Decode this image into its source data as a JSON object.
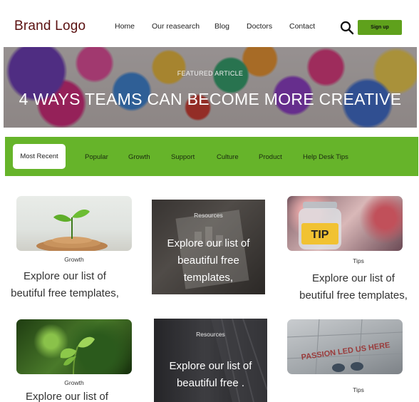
{
  "header": {
    "logo": "Brand Logo",
    "nav": [
      "Home",
      "Our reasearch",
      "Blog",
      "Doctors",
      "Contact"
    ],
    "signup_label": "Sign up"
  },
  "hero": {
    "kicker": "FEATURED ARTICLE",
    "title": "4 WAYS TEAMS CAN BECOME MORE CREATIVE"
  },
  "tabs": {
    "active": "Most Recent",
    "items": [
      "Popular",
      "Growth",
      "Support",
      "Culture",
      "Product",
      "Help Desk Tips"
    ]
  },
  "cards": [
    {
      "category": "Growth",
      "text_line1": "Explore our list of",
      "text_line2": "beutiful free templates,"
    },
    {
      "category": "Resources",
      "text_line1": "Explore our list of",
      "text_line2": "beautiful free",
      "text_line3": "templates,"
    },
    {
      "category": "Tips",
      "text_line1": "Explore our list of",
      "text_line2": "beutiful free templates,",
      "image_text": "TIP"
    },
    {
      "category": "Growth",
      "text_line1": "Explore our list of"
    },
    {
      "category": "Resources",
      "text_line1": "Explore our list of",
      "text_line2": "beautiful free ."
    },
    {
      "category": "Tips",
      "image_text": "PASSION LED US HERE"
    }
  ],
  "colors": {
    "brand": "#5a1010",
    "accent_green": "#66b42a",
    "button_green": "#5fa11c"
  }
}
